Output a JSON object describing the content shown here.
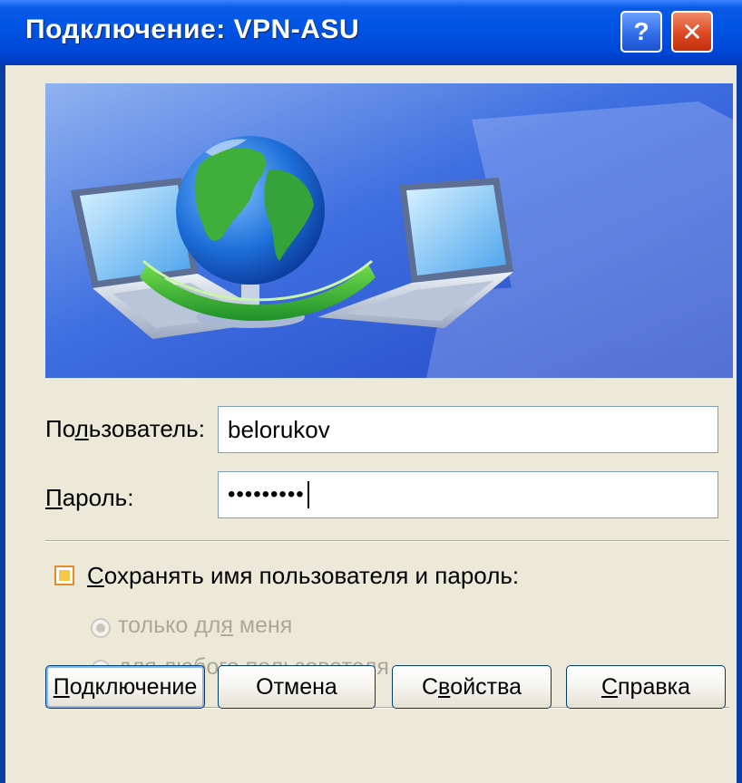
{
  "window": {
    "title": "Подключение: VPN-ASU",
    "help_symbol": "?",
    "close_symbol": "✕"
  },
  "form": {
    "user_label_pre": "По",
    "user_label_key": "л",
    "user_label_post": "ьзователь:",
    "user_value": "belorukov",
    "password_label_key": "П",
    "password_label_post": "ароль:",
    "password_masked": "•••••••••"
  },
  "save_option": {
    "label_key": "С",
    "label_post": "охранять имя пользователя и пароль:",
    "checked": true,
    "options": [
      {
        "pre": "только дл",
        "key": "я",
        "post": " меня",
        "selected": true,
        "disabled": true
      },
      {
        "pre": "для л",
        "key": "ю",
        "post": "бого пользователя",
        "selected": false,
        "disabled": true
      }
    ]
  },
  "buttons": {
    "connect_key": "П",
    "connect_post": "одключение",
    "cancel": "Отмена",
    "props_pre": "С",
    "props_key": "в",
    "props_post": "ойства",
    "help_key": "С",
    "help_post": "правка"
  },
  "colors": {
    "title_bar": "#0055e5",
    "dialog_bg": "#ece9d8",
    "banner_bg": "#2f5bd6",
    "globe_ocean": "#1e6fd9",
    "globe_land": "#3fae3a",
    "checkbox_accent": "#e68b2c"
  },
  "icons": [
    "help-icon",
    "close-icon",
    "globe-icon",
    "laptop-icon"
  ]
}
